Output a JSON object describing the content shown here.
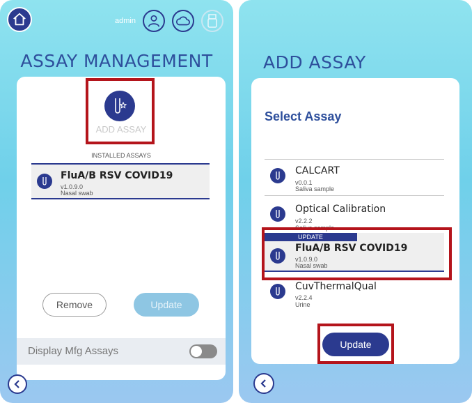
{
  "left": {
    "user_label": "admin",
    "title": "ASSAY MANAGEMENT",
    "add_assay_label": "ADD ASSAY",
    "installed_heading": "INSTALLED ASSAYS",
    "installed": [
      {
        "name": "FluA/B RSV COVID19",
        "version": "v1.0.9.0",
        "sample": "Nasal swab"
      }
    ],
    "remove_label": "Remove",
    "update_label": "Update",
    "mfg_label": "Display Mfg Assays",
    "mfg_toggle": "off"
  },
  "right": {
    "title": "ADD ASSAY",
    "select_heading": "Select Assay",
    "assays": [
      {
        "name": "CALCART",
        "version": "v0.0.1",
        "sample": "Saliva sample"
      },
      {
        "name": "Optical Calibration",
        "version": "v2.2.2",
        "sample": "Saliva sample"
      },
      {
        "name": "FluA/B RSV COVID19",
        "version": "v1.0.9.0",
        "sample": "Nasal swab",
        "badge": "UPDATE"
      },
      {
        "name": "CuvThermalQual",
        "version": "v2.2.4",
        "sample": "Urine"
      }
    ],
    "update_label": "Update"
  },
  "colors": {
    "navy": "#2b3a8f",
    "highlight_red": "#b4141b",
    "disabled_button": "#8ec6e3"
  }
}
